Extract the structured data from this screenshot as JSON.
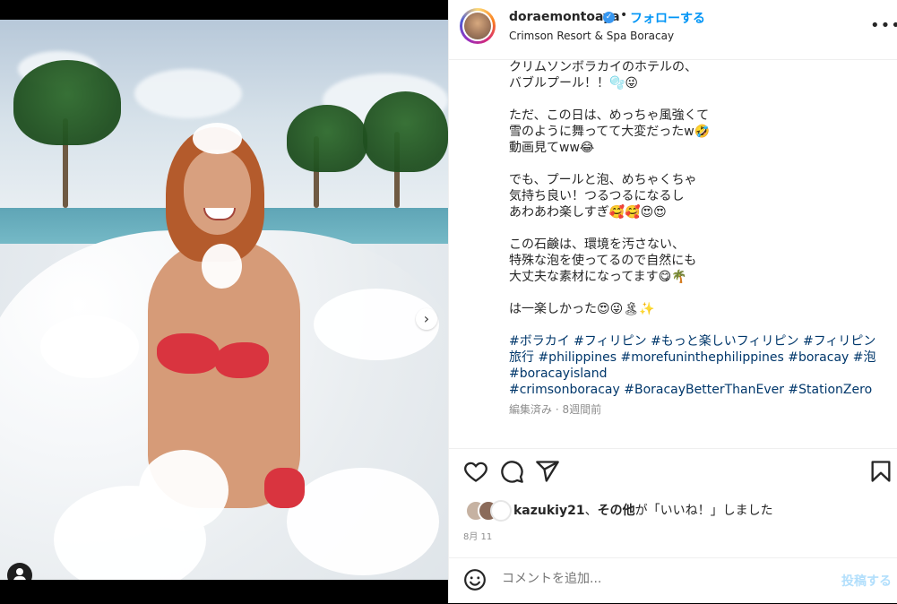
{
  "post": {
    "username": "doraemontoaya",
    "verified_mark": "✓",
    "separator": "•",
    "follow_label": "フォローする",
    "location": "Crimson Resort & Spa Boracay",
    "more_label": "•••"
  },
  "caption": {
    "lines": [
      "クリムソンボラカイのホテルの、",
      "バブルプール！！🫧😜",
      "",
      "ただ、この日は、めっちゃ風強くて",
      "雪のように舞ってて大変だったw🤣",
      "動画見てww😂",
      "",
      "でも、プールと泡、めちゃくちゃ",
      "気持ち良い！つるつるになるし",
      "あわあわ楽しすぎ🥰🥰😍😍",
      "",
      "この石鹸は、環境を汚さない、",
      "特殊な泡を使ってるので自然にも",
      "大丈夫な素材になってます😋🌴",
      "",
      "は一楽しかった😍😜🏝✨"
    ],
    "hashtags": [
      "#ボラカイ #フィリピン #もっと楽しいフィリピン #フィリピン",
      "旅行 #philippines #morefuninthephilippines #boracay #泡パ",
      "#boracayisland",
      "#crimsonboracay #BoracayBetterThanEver #StationZero"
    ],
    "edited": "編集済み · 8週間前"
  },
  "likes": {
    "user": "kazukiy21",
    "sep": "、",
    "others": "その他",
    "suffix": "が「いいね！」しました"
  },
  "date": "8月 11",
  "comment": {
    "placeholder": "コメントを追加...",
    "post_label": "投稿する"
  },
  "media": {
    "next_arrow": "›",
    "carousel_total": 7,
    "carousel_active": 1
  },
  "colors": {
    "accent": "#0095f6",
    "hashtag": "#00376b",
    "muted": "#8e8e8e",
    "text": "#262626"
  },
  "icons": [
    "heart-icon",
    "comment-icon",
    "share-icon",
    "bookmark-icon",
    "emoji-icon",
    "user-tag-icon",
    "chevron-right-icon",
    "more-icon",
    "verified-icon"
  ]
}
